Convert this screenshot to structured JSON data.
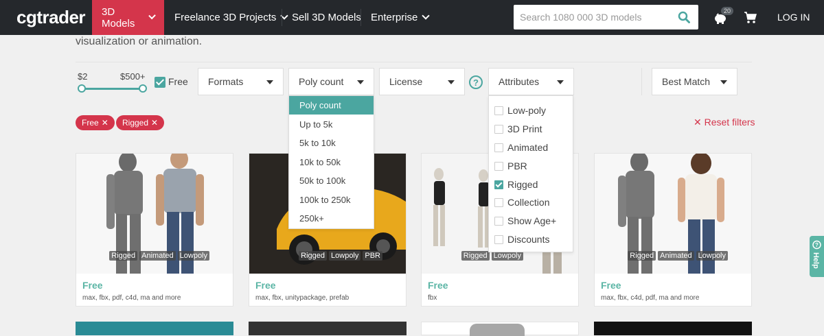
{
  "header": {
    "logo": "cgtrader",
    "nav": [
      {
        "label": "3D Models",
        "active": true,
        "has_chevron": true
      },
      {
        "label": "Freelance 3D Projects",
        "has_chevron": true
      },
      {
        "label": "Sell 3D Models",
        "has_chevron": false
      },
      {
        "label": "Enterprise",
        "has_chevron": true
      }
    ],
    "search_placeholder": "Search 1080 000 3D models",
    "rewards_count": "20",
    "login": "LOG IN"
  },
  "intro_text": "visualization or animation.",
  "filters": {
    "price_min": "$2",
    "price_max": "$500+",
    "free_label": "Free",
    "free_checked": true,
    "formats": "Formats",
    "poly_count": "Poly count",
    "license": "License",
    "help": "?",
    "attributes": "Attributes",
    "sort": "Best Match"
  },
  "poly_menu": [
    "Poly count",
    "Up to 5k",
    "5k to 10k",
    "10k to 50k",
    "50k to 100k",
    "100k to 250k",
    "250k+"
  ],
  "attr_menu": [
    {
      "label": "Low-poly",
      "checked": false
    },
    {
      "label": "3D Print",
      "checked": false
    },
    {
      "label": "Animated",
      "checked": false
    },
    {
      "label": "PBR",
      "checked": false
    },
    {
      "label": "Rigged",
      "checked": true
    },
    {
      "label": "Collection",
      "checked": false
    },
    {
      "label": "Show Age+",
      "checked": false
    },
    {
      "label": "Discounts",
      "checked": false
    }
  ],
  "active_tags": [
    "Free",
    "Rigged"
  ],
  "reset_filters": "Reset filters",
  "cards": [
    {
      "price": "Free",
      "formats": "max, fbx, pdf, c4d, ma and more",
      "badges": [
        "Rigged",
        "Animated",
        "Lowpoly"
      ]
    },
    {
      "price": "Free",
      "formats": "max, fbx, unitypackage, prefab",
      "badges": [
        "Rigged",
        "Lowpoly",
        "PBR"
      ]
    },
    {
      "price": "Free",
      "formats": "fbx",
      "badges": [
        "Rigged",
        "Lowpoly"
      ]
    },
    {
      "price": "Free",
      "formats": "max, fbx, c4d, pdf, ma and more",
      "badges": [
        "Rigged",
        "Animated",
        "Lowpoly"
      ]
    }
  ],
  "help_tab": "Help",
  "colors": {
    "brand_red": "#d4354b",
    "teal": "#4ba6a0",
    "nav_bg": "#25282c"
  }
}
